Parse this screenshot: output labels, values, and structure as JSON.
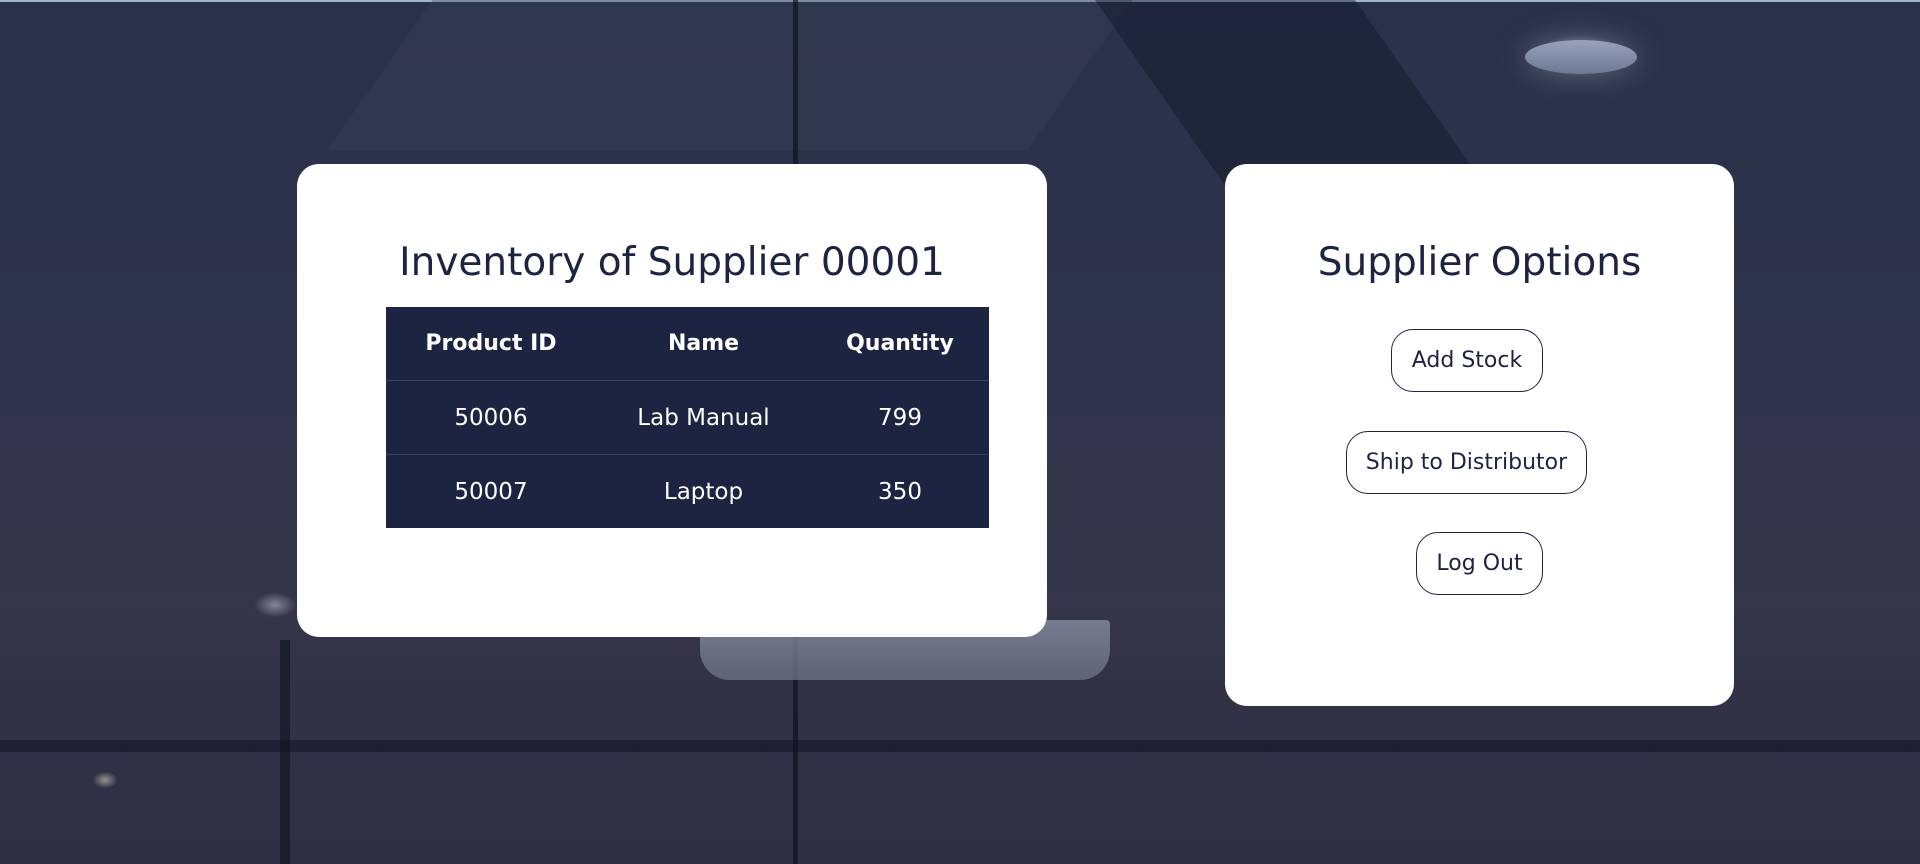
{
  "inventory": {
    "title": "Inventory of Supplier 00001",
    "columns": [
      "Product ID",
      "Name",
      "Quantity"
    ],
    "rows": [
      {
        "product_id": "50006",
        "name": "Lab Manual",
        "quantity": "799"
      },
      {
        "product_id": "50007",
        "name": "Laptop",
        "quantity": "350"
      }
    ]
  },
  "options": {
    "title": "Supplier Options",
    "add_stock_label": "Add Stock",
    "ship_label": "Ship to Distributor",
    "logout_label": "Log Out"
  },
  "colors": {
    "navy": "#1c2442",
    "card": "#ffffff",
    "text": "#1d2441"
  }
}
